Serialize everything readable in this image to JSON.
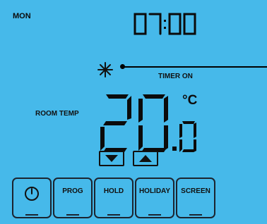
{
  "header": {
    "day": "MON",
    "time": "07:00"
  },
  "timer": {
    "label": "TIMER ON",
    "icon": "snowflake-icon"
  },
  "room": {
    "label": "ROOM TEMP",
    "temp_main": "20",
    "temp_decimal": ".0",
    "unit": "°C"
  },
  "controls": {
    "down_icon": "arrow-down-icon",
    "up_icon": "arrow-up-icon"
  },
  "softkeys": [
    {
      "label": "",
      "icon": "power-icon"
    },
    {
      "label": "PROG"
    },
    {
      "label": "HOLD"
    },
    {
      "label": "HOLIDAY"
    },
    {
      "label": "SCREEN"
    }
  ],
  "colors": {
    "background": "#46b9ea",
    "segment": "#0b0b0b"
  }
}
